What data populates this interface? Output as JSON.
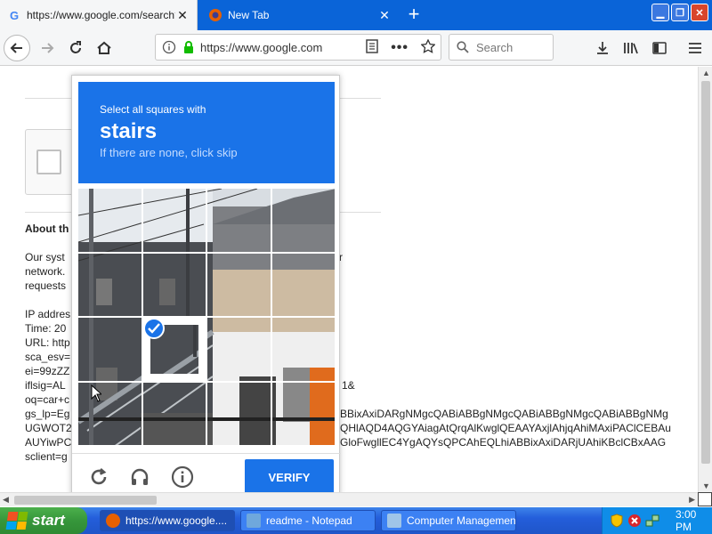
{
  "browser": {
    "tabs": [
      {
        "title": "https://www.google.com/search?",
        "favicon": "google-g-icon",
        "active": true
      },
      {
        "title": "New Tab",
        "favicon": "firefox-icon",
        "active": false
      }
    ],
    "url": "https://www.google.com",
    "search_placeholder": "Search"
  },
  "page": {
    "about_title": "About th",
    "lines": [
      {
        "text": "Our syst",
        "right": "r"
      },
      {
        "text": "network.",
        "right": ""
      },
      {
        "text": "requests",
        "right": ""
      },
      {
        "text": "",
        "right": ""
      },
      {
        "text": "IP addres",
        "right": ""
      },
      {
        "text": "Time: 20",
        "right": ""
      },
      {
        "text": "URL: http",
        "right": ""
      },
      {
        "text": "sca_esv=",
        "right": ""
      },
      {
        "text": "ei=99zZZ",
        "right": ""
      },
      {
        "text": "iflsig=AL",
        "right": "1&"
      },
      {
        "text": "oq=car+c",
        "right": ""
      },
      {
        "text": "gs_lp=Eg",
        "right": "BBixAxiDARgNMgcQABiABBgNMgcQABiABBgNMgcQABiABBgNMg"
      },
      {
        "text": "UGWOT2",
        "right": "QHlAQD4AQGYAiagAtQrqAlKwglQEAAYAxjlAhjqAhiMAxiPAClCEBAu"
      },
      {
        "text": "AUYiwPC",
        "right": "GloFwgllEC4YgAQYsQPCAhEQLhiABBixAxiDARjUAhiKBclCBxAAG"
      },
      {
        "text": "sclient=g",
        "right": ""
      }
    ]
  },
  "captcha": {
    "instruction": "Select all squares with",
    "keyword": "stairs",
    "hint": "If there are none, click skip",
    "selected_tiles": [
      9
    ],
    "verify_label": "VERIFY",
    "footer_icons": [
      "reload-icon",
      "audio-icon",
      "info-icon"
    ]
  },
  "taskbar": {
    "start_label": "start",
    "tasks": [
      {
        "label": "https://www.google....",
        "icon": "firefox-icon",
        "color": "#e66000"
      },
      {
        "label": "readme - Notepad",
        "icon": "notepad-icon",
        "color": "#6fa8dc"
      },
      {
        "label": "Computer Management",
        "icon": "computer-management-icon",
        "color": "#9fc5e8"
      }
    ],
    "clock": "3:00 PM"
  },
  "colors": {
    "accent": "#1a73e8",
    "taskbar": "#245edb",
    "start": "#36963b"
  }
}
